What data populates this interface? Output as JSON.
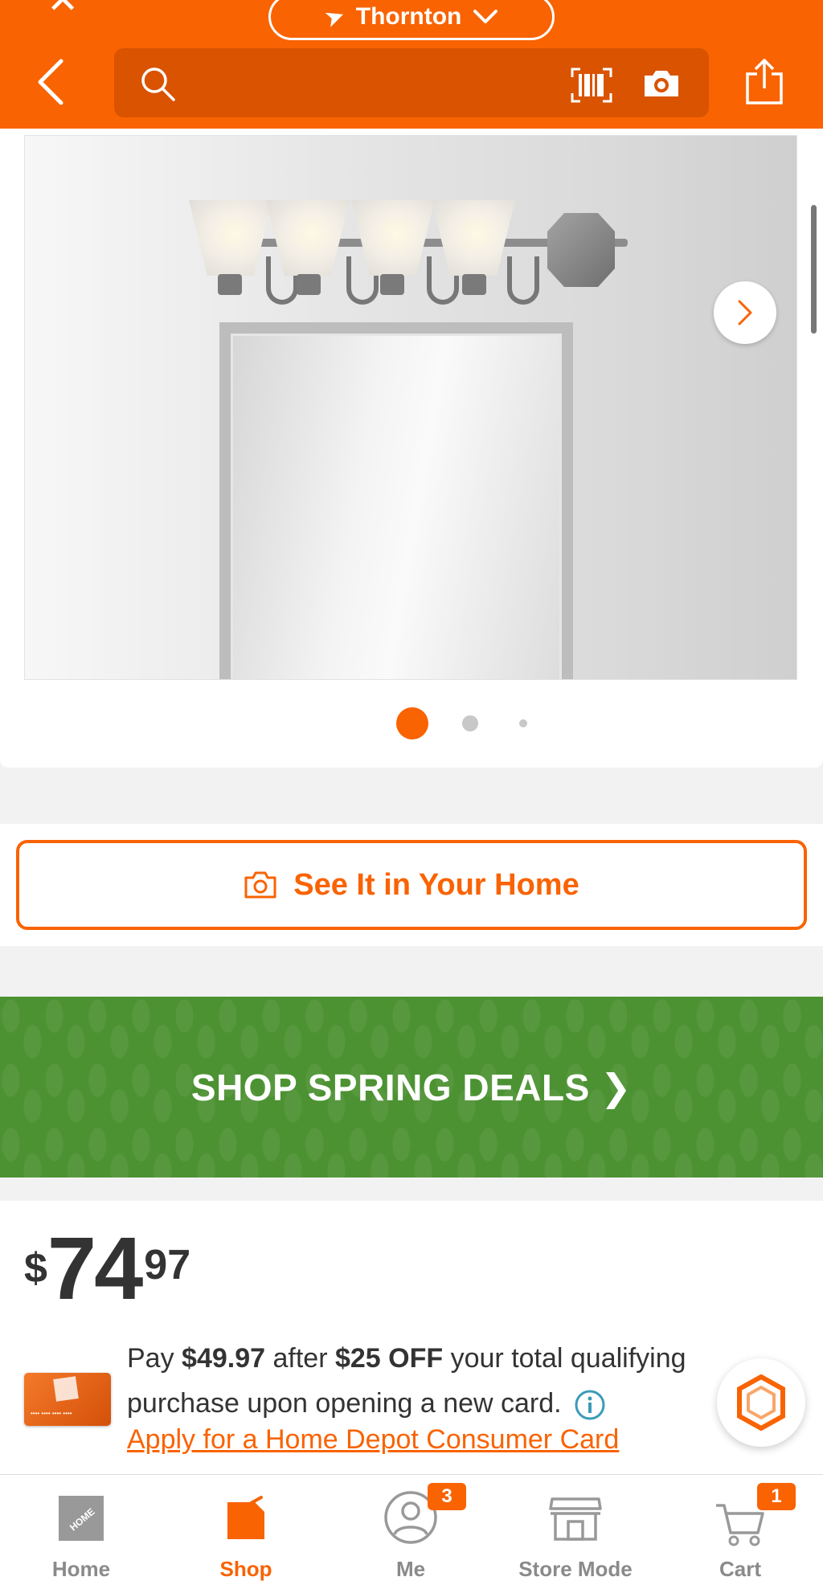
{
  "header": {
    "store_name": "Thornton",
    "icons": {
      "close": "close-icon",
      "back": "back-chevron-icon",
      "search": "search-icon",
      "barcode": "barcode-scanner-icon",
      "camera": "camera-icon",
      "share": "share-icon",
      "location": "location-arrow-icon",
      "dropdown": "chevron-down-icon"
    },
    "colors": {
      "brand": "#f96302",
      "search_bg": "#d95300"
    }
  },
  "gallery": {
    "image_alt": "Four-light brushed nickel vanity light above a framed mirror",
    "current_index": 1,
    "total_dots": 3
  },
  "see_it": {
    "label": "See It in Your Home",
    "icon": "camera-icon"
  },
  "promo": {
    "label": "SHOP SPRING DEALS ❯",
    "color": "#4c9232"
  },
  "price": {
    "currency": "$",
    "dollars": "74",
    "cents": "97"
  },
  "offer": {
    "pre": "Pay ",
    "amount": "$49.97",
    "mid": " after ",
    "discount": "$25 OFF",
    "post": " your total qualifying purchase upon opening a new card.",
    "link": "Apply for a Home Depot Consumer Card"
  },
  "tabs": [
    {
      "label": "Home",
      "icon": "home-depot-logo-icon",
      "active": false,
      "badge": ""
    },
    {
      "label": "Shop",
      "icon": "shop-tag-icon",
      "active": true,
      "badge": ""
    },
    {
      "label": "Me",
      "icon": "user-icon",
      "active": false,
      "badge": "3"
    },
    {
      "label": "Store Mode",
      "icon": "store-icon",
      "active": false,
      "badge": ""
    },
    {
      "label": "Cart",
      "icon": "cart-icon",
      "active": false,
      "badge": "1"
    }
  ]
}
